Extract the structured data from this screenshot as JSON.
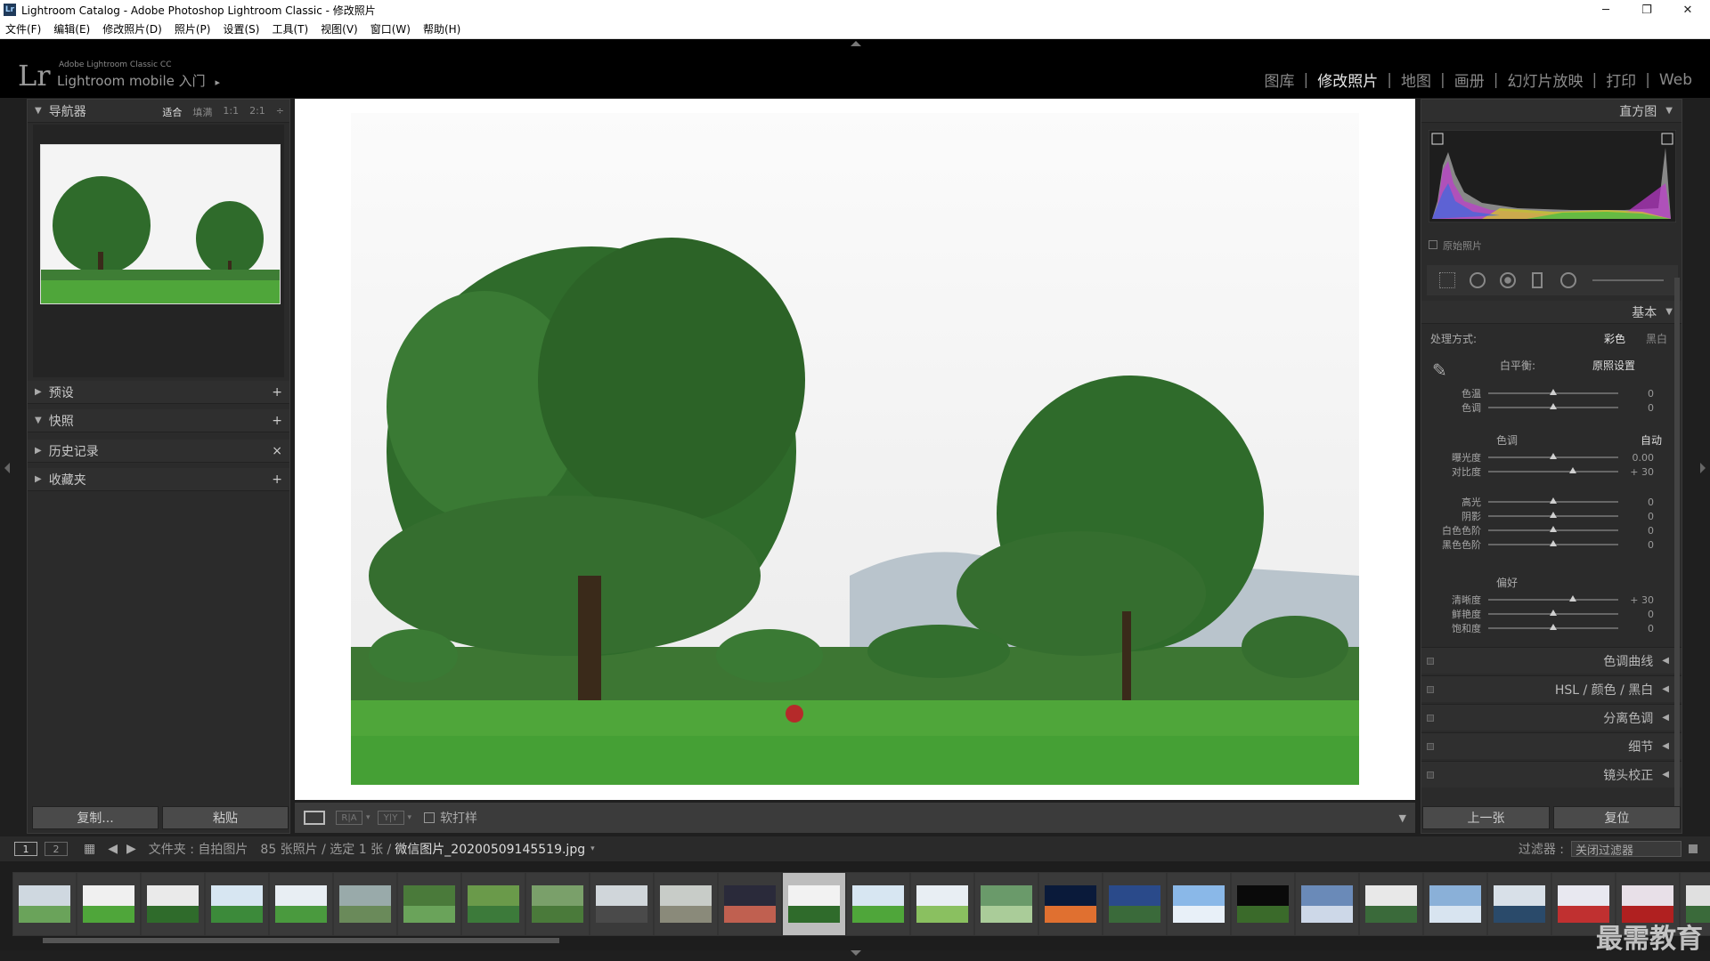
{
  "window": {
    "title": "Lightroom Catalog - Adobe Photoshop Lightroom Classic - 修改照片",
    "app_icon": "Lr",
    "minimize": "─",
    "maximize": "❐",
    "close": "✕"
  },
  "menu": [
    "文件(F)",
    "编辑(E)",
    "修改照片(D)",
    "照片(P)",
    "设置(S)",
    "工具(T)",
    "视图(V)",
    "窗口(W)",
    "帮助(H)"
  ],
  "identity": {
    "logo": "Lr",
    "product": "Adobe Lightroom Classic CC",
    "mobile": "Lightroom mobile 入门",
    "mobile_arrow": "▸"
  },
  "modules": [
    "图库",
    "修改照片",
    "地图",
    "画册",
    "幻灯片放映",
    "打印",
    "Web"
  ],
  "module_separator": "|",
  "active_module": "修改照片",
  "left_panel": {
    "navigator": {
      "title": "导航器",
      "options": [
        "适合",
        "填满",
        "1:1",
        "2:1"
      ],
      "active": "适合",
      "stepper": "÷"
    },
    "presets": {
      "title": "预设",
      "action": "+"
    },
    "snapshots": {
      "title": "快照",
      "action": "+"
    },
    "history": {
      "title": "历史记录",
      "action": "×"
    },
    "collections": {
      "title": "收藏夹",
      "action": "+"
    },
    "copy_button": "复制...",
    "paste_button": "粘贴"
  },
  "toolbar": {
    "view_buttons": [
      "",
      "R|A",
      "Y|Y"
    ],
    "soft_proof": "软打样"
  },
  "right_panel": {
    "histogram": {
      "title": "直方图",
      "original_photo": "原始照片"
    },
    "basic": {
      "title": "基本",
      "treatment_label": "处理方式:",
      "treatment_options": [
        "彩色",
        "黑白"
      ],
      "treatment_active": "彩色",
      "wb_label": "白平衡:",
      "wb_value": "原照设置",
      "wb_sliders": [
        {
          "label": "色温",
          "value": "0",
          "pos": 0.5
        },
        {
          "label": "色调",
          "value": "0",
          "pos": 0.5
        }
      ],
      "tone_title": "色调",
      "tone_auto": "自动",
      "tone_sliders": [
        {
          "label": "曝光度",
          "value": "0.00",
          "pos": 0.5
        },
        {
          "label": "对比度",
          "value": "+ 30",
          "pos": 0.65
        }
      ],
      "tone_sliders2": [
        {
          "label": "高光",
          "value": "0",
          "pos": 0.5
        },
        {
          "label": "阴影",
          "value": "0",
          "pos": 0.5
        },
        {
          "label": "白色色阶",
          "value": "0",
          "pos": 0.5
        },
        {
          "label": "黑色色阶",
          "value": "0",
          "pos": 0.5
        }
      ],
      "presence_title": "偏好",
      "presence_sliders": [
        {
          "label": "清晰度",
          "value": "+ 30",
          "pos": 0.65
        },
        {
          "label": "鲜艳度",
          "value": "0",
          "pos": 0.5
        },
        {
          "label": "饱和度",
          "value": "0",
          "pos": 0.5
        }
      ]
    },
    "panels": [
      "色调曲线",
      "HSL / 颜色 / 黑白",
      "分离色调",
      "细节",
      "镜头校正"
    ],
    "prev_button": "上一张",
    "reset_button": "复位"
  },
  "filmstrip_bar": {
    "pages": [
      "1",
      "2"
    ],
    "folder_label": "文件夹 : 自拍图片",
    "count": "85 张照片 / 选定 1 张 /",
    "filename": "微信图片_20200509145519.jpg",
    "filter_label": "过滤器 :",
    "filter_value": "关闭过滤器"
  },
  "watermark": "最需教育",
  "colors": {
    "accent": "#e8e8e8",
    "panel_bg": "#2b2b2b",
    "sky": "#f2f2f2",
    "grass": "#4fa63a",
    "tree": "#2c6a2a"
  }
}
